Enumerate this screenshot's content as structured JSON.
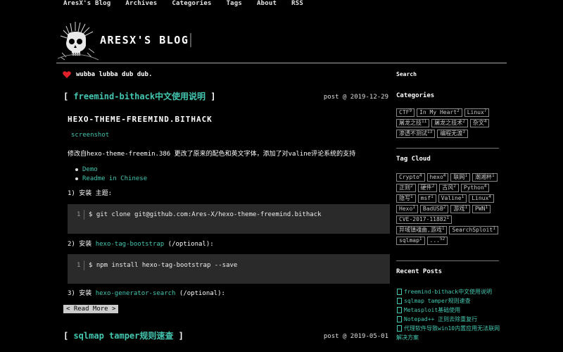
{
  "nav": [
    "AresX's Blog",
    "Archives",
    "Categories",
    "Tags",
    "About",
    "RSS"
  ],
  "site": {
    "title": "ARESX'S BLOG",
    "motto": "wubba lubba dub dub."
  },
  "colors": {
    "accent": "#43c7b0",
    "background": "#000000",
    "code_bg": "#2a2a2a"
  },
  "post1": {
    "title_link": "freemind-bithack中文使用说明",
    "meta": "post @ 2019-12-29",
    "heading": "HEXO-THEME-FREEMIND.BITHACK",
    "screenshot": "screenshot",
    "description": "修改自hexo-theme-freemin.386 更改了原来的配色和英文字体，添加了对valine评论系统的支持",
    "links": [
      "Demo",
      "Readme in Chinese"
    ],
    "step1": "1) 安装 主题:",
    "code1_ln": "1",
    "code1": "$ git clone git@github.com:Ares-X/hexo-theme-freemind.bithack",
    "step2_pre": "2) 安装",
    "step2_link": "hexo-tag-bootstrap",
    "step2_post": "(/optional):",
    "code2_ln": "1",
    "code2": "$ npm install hexo-tag-bootstrap --save",
    "step3_pre": "3) 安装",
    "step3_link": "hexo-generator-search",
    "step3_post": "(/optional):",
    "readmore": "< Read More >"
  },
  "post2": {
    "title_link": "sqlmap tamper规则速查",
    "meta": "post @ 2019-05-01"
  },
  "sidebar": {
    "search_heading": "Search",
    "categories_heading": "Categories",
    "categories": [
      {
        "name": "CTF",
        "count": "9"
      },
      {
        "name": "In My Heart",
        "count": "2"
      },
      {
        "name": "Linux",
        "count": "7"
      },
      {
        "name": "屠龙之技",
        "count": "11"
      },
      {
        "name": "屠龙之技术",
        "count": "2"
      },
      {
        "name": "杂文",
        "count": "4"
      },
      {
        "name": "渗透不测试",
        "count": "13"
      },
      {
        "name": "编程无渡",
        "count": "3"
      }
    ],
    "tagcloud_heading": "Tag Cloud",
    "tags": [
      {
        "name": "Crypto",
        "count": "4"
      },
      {
        "name": "hexo",
        "count": "4"
      },
      {
        "name": "联网",
        "count": "1"
      },
      {
        "name": "潮湘杯",
        "count": "1"
      },
      {
        "name": "正则",
        "count": "2"
      },
      {
        "name": "硬件",
        "count": "2"
      },
      {
        "name": "古风",
        "count": "2"
      },
      {
        "name": "Python",
        "count": "4"
      },
      {
        "name": "隐写",
        "count": "1"
      },
      {
        "name": "msf",
        "count": "1"
      },
      {
        "name": "Valine",
        "count": "1"
      },
      {
        "name": "Linux",
        "count": "4"
      },
      {
        "name": "Hexo",
        "count": "1"
      },
      {
        "name": "BadUSB",
        "count": "2"
      },
      {
        "name": "游戏",
        "count": "1"
      },
      {
        "name": "PWN",
        "count": "1"
      },
      {
        "name": "CVE-2017-11882",
        "count": "1"
      },
      {
        "name": "异域镇魂曲,游戏",
        "count": "1"
      },
      {
        "name": "SearchSploit",
        "count": "1"
      },
      {
        "name": "sqlmap",
        "count": "1"
      },
      {
        "name": "...",
        "count": "52"
      }
    ],
    "recent_heading": "Recent Posts",
    "recent": [
      "freemind-bithack中文使用说明",
      "sqlmap tamper规则速查",
      "Metasploit基础使用",
      "Notepad++ 正则去除重复行",
      "代理软件导致win10内置应用无法联网",
      "解决方案"
    ]
  }
}
